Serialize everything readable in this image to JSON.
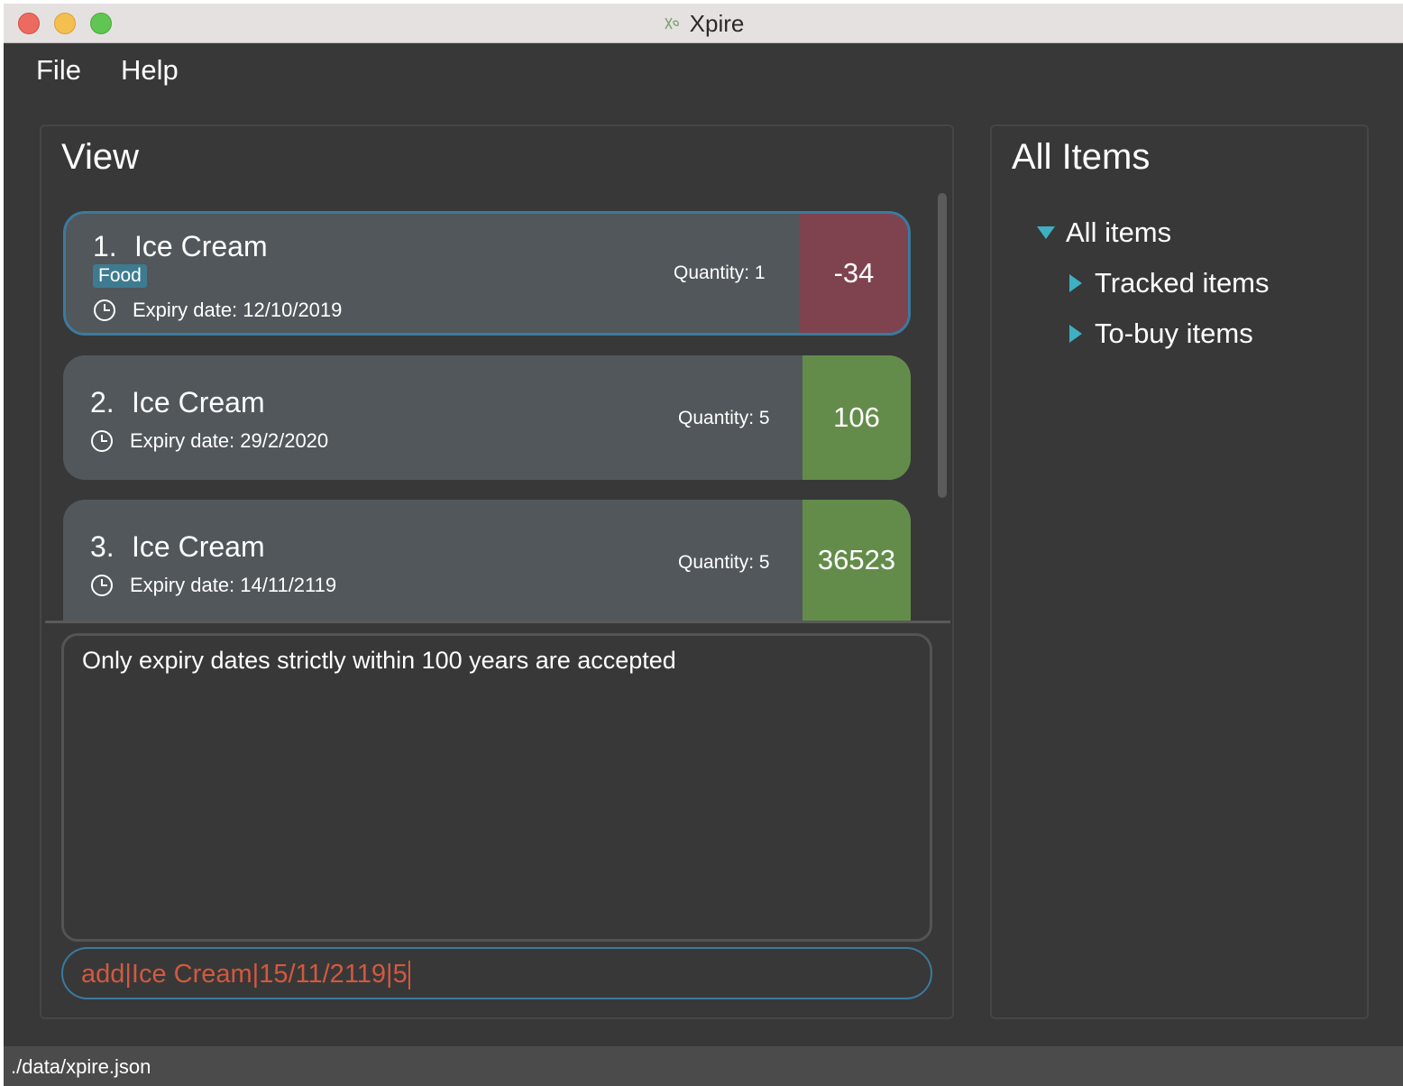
{
  "window": {
    "title": "Xpire",
    "app_icon": "xpire-leaf-icon"
  },
  "menubar": {
    "items": [
      {
        "label": "File"
      },
      {
        "label": "Help"
      }
    ]
  },
  "view_panel": {
    "title": "View",
    "items": [
      {
        "index": "1.",
        "name": "Ice Cream",
        "tag": "Food",
        "expiry": "Expiry date: 12/10/2019",
        "quantity": "Quantity: 1",
        "days": "-34",
        "status_color": "#7f434f",
        "selected": true
      },
      {
        "index": "2.",
        "name": "Ice Cream",
        "tag": "",
        "expiry": "Expiry date: 29/2/2020",
        "quantity": "Quantity: 5",
        "days": "106",
        "status_color": "#638c4a",
        "selected": false
      },
      {
        "index": "3.",
        "name": "Ice Cream",
        "tag": "",
        "expiry": "Expiry date: 14/11/2119",
        "quantity": "Quantity: 5",
        "days": "36523",
        "status_color": "#638c4a",
        "selected": false
      }
    ],
    "result_text": "Only expiry dates strictly within 100 years are accepted",
    "command_input": "add|Ice Cream|15/11/2119|5"
  },
  "items_panel": {
    "title": "All Items",
    "tree": {
      "root": "All items",
      "children": [
        "Tracked items",
        "To-buy items"
      ]
    }
  },
  "statusbar": {
    "path": "./data/xpire.json"
  },
  "colors": {
    "accent": "#3eb0c2",
    "selection_border": "#3b7a9e",
    "expired": "#7f434f",
    "healthy": "#638c4a",
    "command_text": "#d2593f"
  }
}
